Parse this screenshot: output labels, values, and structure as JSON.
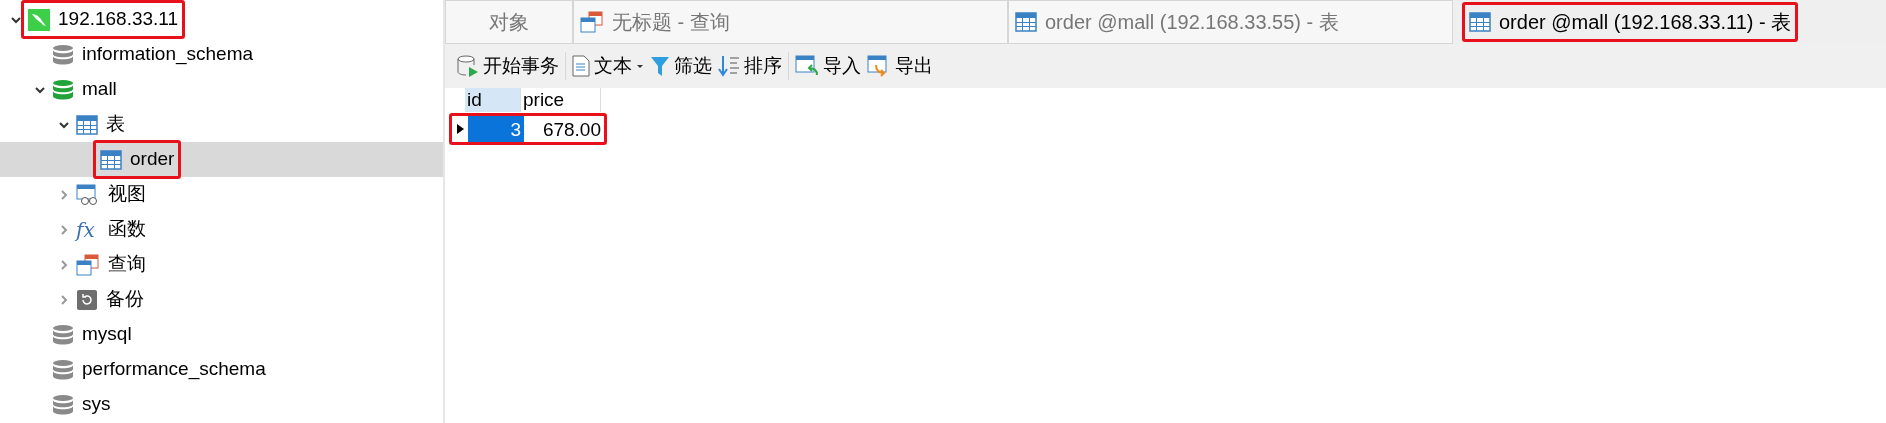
{
  "sidebar": {
    "connection": {
      "label": "192.168.33.11",
      "expanded": true,
      "selected": false,
      "annotated": true,
      "children": [
        {
          "label": "information_schema",
          "kind": "database",
          "selected": false,
          "annotated": false
        },
        {
          "label": "mall",
          "kind": "database",
          "expanded": true,
          "selected": false,
          "annotated": false,
          "children": [
            {
              "label": "表",
              "kind": "tables",
              "expanded": true,
              "selected": false,
              "annotated": false,
              "children": [
                {
                  "label": "order",
                  "kind": "table",
                  "selected": true,
                  "annotated": true
                }
              ]
            },
            {
              "label": "视图",
              "kind": "views",
              "expanded": false,
              "selected": false,
              "annotated": false
            },
            {
              "label": "函数",
              "kind": "functions",
              "icon": "fx",
              "expanded": false,
              "selected": false,
              "annotated": false
            },
            {
              "label": "查询",
              "kind": "queries",
              "expanded": false,
              "selected": false,
              "annotated": false
            },
            {
              "label": "备份",
              "kind": "backups",
              "expanded": false,
              "selected": false,
              "annotated": false
            }
          ]
        },
        {
          "label": "mysql",
          "kind": "database",
          "selected": false,
          "annotated": false
        },
        {
          "label": "performance_schema",
          "kind": "database",
          "selected": false,
          "annotated": false
        },
        {
          "label": "sys",
          "kind": "database",
          "selected": false,
          "annotated": false
        }
      ]
    }
  },
  "tabs": [
    {
      "label": "对象",
      "kind": "objects",
      "selected": false,
      "annotated": false
    },
    {
      "label": "无标题 - 查询",
      "kind": "query",
      "selected": false,
      "annotated": false
    },
    {
      "label": "order @mall (192.168.33.55) - 表",
      "kind": "table",
      "selected": false,
      "annotated": false
    },
    {
      "label": "order @mall (192.168.33.11) - 表",
      "kind": "table",
      "selected": true,
      "annotated": true
    }
  ],
  "toolbar": [
    [
      {
        "label": "开始事务",
        "kind": "transaction"
      }
    ],
    [
      {
        "label": "文本",
        "kind": "text",
        "dropdown": true
      },
      {
        "label": "筛选",
        "kind": "filter"
      },
      {
        "label": "排序",
        "kind": "sort"
      }
    ],
    [
      {
        "label": "导入",
        "kind": "import"
      },
      {
        "label": "导出",
        "kind": "export"
      }
    ]
  ],
  "grid": {
    "columns": [
      {
        "label": "id",
        "selected": true
      },
      {
        "label": "price",
        "selected": false
      }
    ],
    "rows": [
      {
        "cells": [
          "3",
          "678.00"
        ],
        "selected": true,
        "annotated": true
      }
    ]
  }
}
